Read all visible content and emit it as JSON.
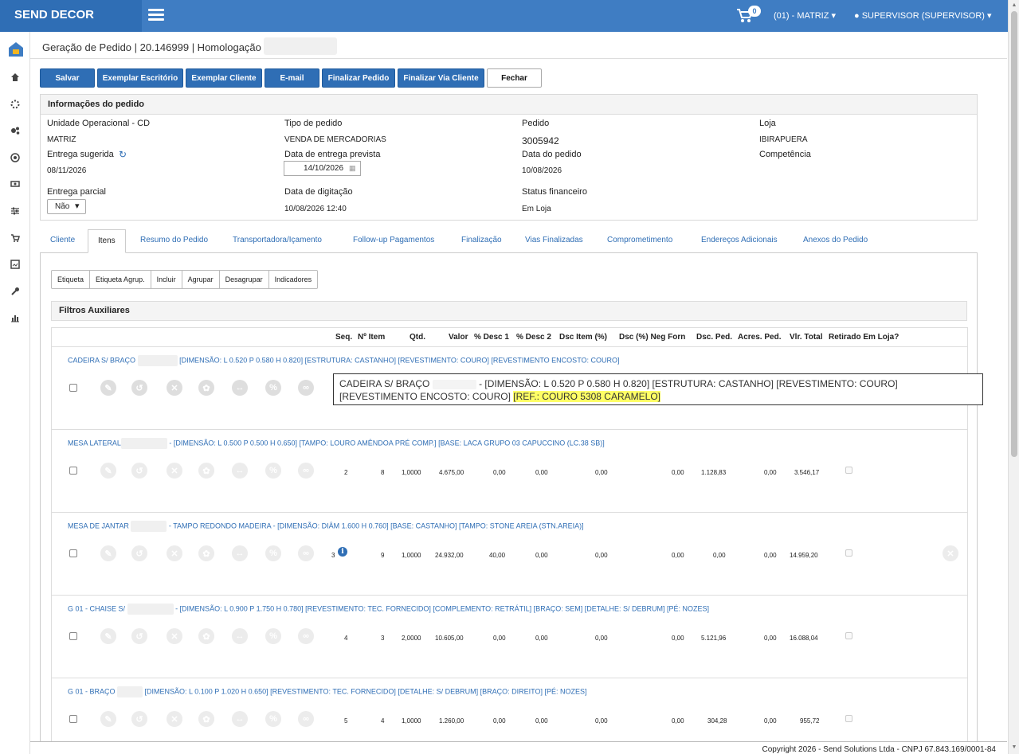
{
  "app": {
    "brand": "SEND DECOR",
    "cart_count": "0",
    "store_menu": "(01) - MATRIZ",
    "user_menu": "SUPERVISOR (SUPERVISOR)"
  },
  "breadcrumb": "Geração de Pedido | 20.146999 | Homologação |",
  "toolbar": [
    "Salvar",
    "Exemplar Escritório",
    "Exemplar Cliente",
    "E-mail",
    "Finalizar Pedido",
    "Finalizar Via Cliente",
    "Fechar"
  ],
  "info": {
    "title": "Informações do pedido",
    "unidade_label": "Unidade Operacional - CD",
    "unidade_val": "MATRIZ",
    "tipo_label": "Tipo de pedido",
    "tipo_val": "VENDA DE MERCADORIAS",
    "pedido_label": "Pedido",
    "pedido_val": "3005942",
    "loja_label": "Loja",
    "loja_val": "IBIRAPUERA",
    "entrega_label": "Entrega sugerida",
    "entrega_val": "08/11/2026",
    "prevista_label": "Data de entrega prevista",
    "prevista_val": "14/10/2026",
    "data_pedido_label": "Data do pedido",
    "data_pedido_val": "10/08/2026",
    "competencia_label": "Competência",
    "parcial_label": "Entrega parcial",
    "parcial_val": "Não",
    "digitacao_label": "Data de digitação",
    "digitacao_val": "10/08/2026 12:40",
    "status_label": "Status financeiro",
    "status_val": "Em Loja"
  },
  "tabs": [
    "Cliente",
    "Itens",
    "Resumo do Pedido",
    "Transportadora/Içamento",
    "Follow-up Pagamentos",
    "Finalização",
    "Vias Finalizadas",
    "Comprometimento",
    "Endereços Adicionais",
    "Anexos do Pedido"
  ],
  "subtoolbar": [
    "Etiqueta",
    "Etiqueta Agrup.",
    "Incluir",
    "Agrupar",
    "Desagrupar",
    "Indicadores"
  ],
  "filters_title": "Filtros Auxiliares",
  "grid_headers": [
    "Seq.",
    "Nº Item",
    "Qtd.",
    "Valor",
    "% Desc 1",
    "% Desc 2",
    "Dsc Item (%)",
    "Dsc (%) Neg Forn",
    "Dsc. Ped.",
    "Acres. Ped.",
    "Vlr. Total",
    "Retirado Em Loja?"
  ],
  "rows": [
    {
      "t1": "CADEIRA S/ BRAÇO",
      "t2": "[DIMENSÃO: L 0.520 P 0.580 H 0.820] [ESTRUTURA: CASTANHO] [REVESTIMENTO: COURO] [REVESTIMENTO ENCOSTO: COURO]",
      "vals": [
        "",
        "",
        "",
        "",
        "",
        "",
        "",
        "",
        "",
        "",
        "",
        ""
      ]
    },
    {
      "t1": "MESA LATERAL",
      "t2": "- [DIMENSÃO: L 0.500 P 0.500 H 0.650] [TAMPO: LOURO AMÊNDOA PRÉ COMP.] [BASE: LACA GRUPO 03 CAPUCCINO (LC.38 SB)]",
      "vals": [
        "2",
        "8",
        "1,0000",
        "4.675,00",
        "0,00",
        "0,00",
        "0,00",
        "0,00",
        "1.128,83",
        "0,00",
        "3.546,17"
      ]
    },
    {
      "t1": "MESA DE JANTAR",
      "t2": "- TAMPO REDONDO MADEIRA - [DIMENSÃO: DIÂM 1.600 H 0.760] [BASE: CASTANHO] [TAMPO: STONE AREIA (STN.AREIA)]",
      "vals": [
        "3",
        "9",
        "1,0000",
        "24.932,00",
        "40,00",
        "0,00",
        "0,00",
        "0,00",
        "0,00",
        "0,00",
        "14.959,20"
      ]
    },
    {
      "t1": "G 01 - CHAISE S/",
      "t2": "- [DIMENSÃO: L 0.900 P 1.750 H 0.780] [REVESTIMENTO: TEC. FORNECIDO] [COMPLEMENTO: RETRÁTIL] [BRAÇO: SEM] [DETALHE: S/ DEBRUM] [PÉ: NOZES]",
      "vals": [
        "4",
        "3",
        "2,0000",
        "10.605,00",
        "0,00",
        "0,00",
        "0,00",
        "0,00",
        "5.121,96",
        "0,00",
        "16.088,04"
      ]
    },
    {
      "t1": "G 01 - BRAÇO",
      "t2": "[DIMENSÃO: L 0.100 P 1.020 H 0.650] [REVESTIMENTO: TEC. FORNECIDO] [DETALHE: S/ DEBRUM] [BRAÇO: DIREITO] [PÉ: NOZES]",
      "vals": [
        "5",
        "4",
        "1,0000",
        "1.260,00",
        "0,00",
        "0,00",
        "0,00",
        "0,00",
        "304,28",
        "0,00",
        "955,72"
      ]
    }
  ],
  "tooltip": {
    "part1": "CADEIRA S/ BRAÇO",
    "part2": "- [DIMENSÃO: L 0.520 P 0.580 H 0.820] [ESTRUTURA: CASTANHO] [REVESTIMENTO: COURO] [REVESTIMENTO ENCOSTO: COURO]",
    "highlight": "[REF.: COURO 5308 CARAMELO]"
  },
  "footer": "Copyright 2026 - Send Solutions Ltda - CNPJ 67.843.169/0001-84"
}
